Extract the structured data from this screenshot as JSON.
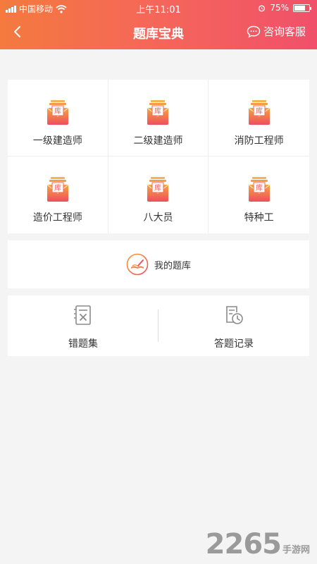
{
  "status_bar": {
    "carrier": "中国移动",
    "time": "上午11:01",
    "battery": "75%",
    "battery_level": 0.75
  },
  "navbar": {
    "title": "题库宝典",
    "back_icon": "chevron-left-icon",
    "service_label": "咨询客服",
    "service_icon": "chat-bubble-icon"
  },
  "categories": [
    {
      "label": "一级建造师",
      "icon_char": "库"
    },
    {
      "label": "二级建造师",
      "icon_char": "库"
    },
    {
      "label": "消防工程师",
      "icon_char": "库"
    },
    {
      "label": "造价工程师",
      "icon_char": "库"
    },
    {
      "label": "八大员",
      "icon_char": "库"
    },
    {
      "label": "特种工",
      "icon_char": "库"
    }
  ],
  "my_bank": {
    "label": "我的题库",
    "icon": "book-pen-icon"
  },
  "tools": [
    {
      "label": "错题集",
      "icon": "wrong-notebook-icon"
    },
    {
      "label": "答题记录",
      "icon": "history-clock-icon"
    }
  ],
  "watermark": {
    "number": "2265",
    "text": "手游网"
  },
  "colors": {
    "header_gradient_start": "#f47a3e",
    "header_gradient_end": "#f0506a",
    "accent": "#f5665a",
    "background": "#f4f4f4"
  }
}
